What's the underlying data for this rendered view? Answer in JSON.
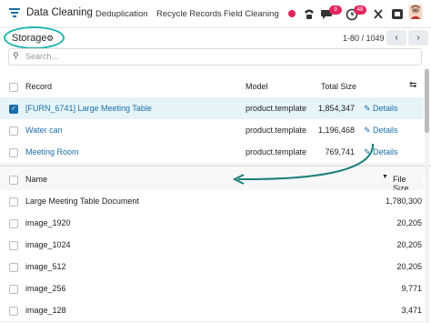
{
  "nav": {
    "app_title": "Data Cleaning",
    "menu": [
      "Deduplication",
      "Recycle Records",
      "Field Cleaning"
    ],
    "messages_badge": "9",
    "activity_badge": "48"
  },
  "control": {
    "breadcrumb": "Storage",
    "pager": "1-80 / 1049",
    "search_placeholder": "Search..."
  },
  "upper_table": {
    "headers": {
      "record": "Record",
      "model": "Model",
      "size": "Total Size"
    },
    "rows": [
      {
        "record": "[FURN_6741] Large Meeting Table",
        "model": "product.template",
        "size": "1,854,347",
        "action": "Details",
        "selected": true
      },
      {
        "record": "Water can",
        "model": "product.template",
        "size": "1,196,468",
        "action": "Details",
        "selected": false
      },
      {
        "record": "Meeting Room",
        "model": "product.template",
        "size": "769,741",
        "action": "Details",
        "selected": false
      }
    ]
  },
  "lower_table": {
    "headers": {
      "name": "Name",
      "size": "File Size"
    },
    "rows": [
      {
        "name": "Large Meeting Table Document",
        "size": "1,780,300"
      },
      {
        "name": "image_1920",
        "size": "20,205"
      },
      {
        "name": "image_1024",
        "size": "20,205"
      },
      {
        "name": "image_512",
        "size": "20,205"
      },
      {
        "name": "image_256",
        "size": "9,771"
      },
      {
        "name": "image_128",
        "size": "3,471"
      }
    ]
  },
  "colors": {
    "accent": "#1a6fa8",
    "annotation": "#1fb5b0",
    "badge": "#e0245e"
  }
}
